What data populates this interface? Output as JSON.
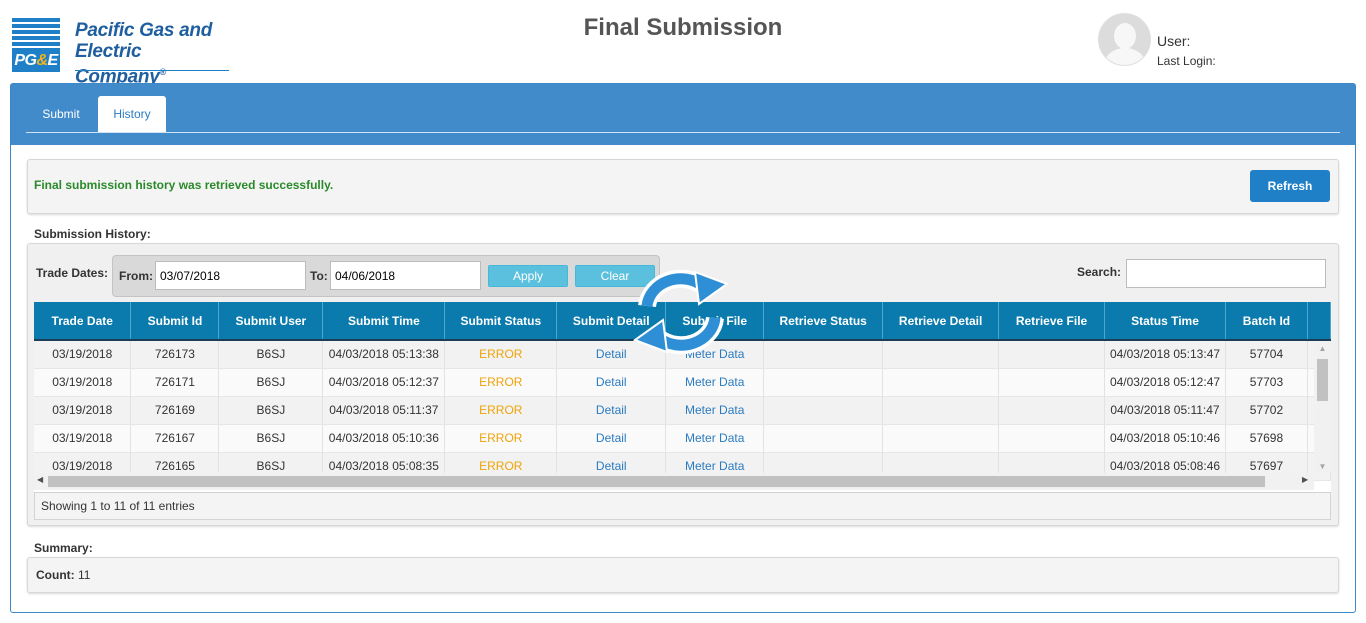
{
  "logo": {
    "mark_left": "PG",
    "mark_amp": "&",
    "mark_right": "E",
    "line1": "Pacific Gas and",
    "line2": "Electric Company",
    "reg": "®"
  },
  "page_title": "Final Submission",
  "user": {
    "user_label": "User:",
    "last_login_label": "Last Login:"
  },
  "tabs": [
    {
      "label": "Submit"
    },
    {
      "label": "History"
    }
  ],
  "message": {
    "text": "Final submission history was retrieved successfully.",
    "refresh_label": "Refresh"
  },
  "history": {
    "section_label": "Submission History:",
    "trade_dates_label": "Trade Dates:",
    "from_label": "From:",
    "from_value": "03/07/2018",
    "to_label": "To:",
    "to_value": "04/06/2018",
    "apply_label": "Apply",
    "clear_label": "Clear",
    "search_label": "Search:",
    "search_value": "",
    "columns": [
      "Trade Date",
      "Submit Id",
      "Submit User",
      "Submit Time",
      "Submit Status",
      "Submit Detail",
      "Submit File",
      "Retrieve Status",
      "Retrieve Detail",
      "Retrieve File",
      "Status Time",
      "Batch Id"
    ],
    "rows": [
      [
        "03/19/2018",
        "726173",
        "B6SJ",
        "04/03/2018 05:13:38",
        "ERROR",
        "Detail",
        "Meter Data",
        "",
        "",
        "",
        "04/03/2018 05:13:47",
        "57704"
      ],
      [
        "03/19/2018",
        "726171",
        "B6SJ",
        "04/03/2018 05:12:37",
        "ERROR",
        "Detail",
        "Meter Data",
        "",
        "",
        "",
        "04/03/2018 05:12:47",
        "57703"
      ],
      [
        "03/19/2018",
        "726169",
        "B6SJ",
        "04/03/2018 05:11:37",
        "ERROR",
        "Detail",
        "Meter Data",
        "",
        "",
        "",
        "04/03/2018 05:11:47",
        "57702"
      ],
      [
        "03/19/2018",
        "726167",
        "B6SJ",
        "04/03/2018 05:10:36",
        "ERROR",
        "Detail",
        "Meter Data",
        "",
        "",
        "",
        "04/03/2018 05:10:46",
        "57698"
      ],
      [
        "03/19/2018",
        "726165",
        "B6SJ",
        "04/03/2018 05:08:35",
        "ERROR",
        "Detail",
        "Meter Data",
        "",
        "",
        "",
        "04/03/2018 05:08:46",
        "57697"
      ]
    ],
    "showing_text": "Showing 1 to 11 of 11 entries"
  },
  "summary": {
    "section_label": "Summary:",
    "count_label": "Count:",
    "count_value": "11"
  },
  "colors": {
    "brand_blue": "#1f80c8",
    "header_blue": "#0b7bad",
    "tabbar_blue": "#418bca",
    "error_orange": "#f0a30a",
    "success_green": "#2a8a2a"
  },
  "icons": {
    "loading": "refresh-spinner-icon",
    "avatar": "user-avatar-icon"
  }
}
